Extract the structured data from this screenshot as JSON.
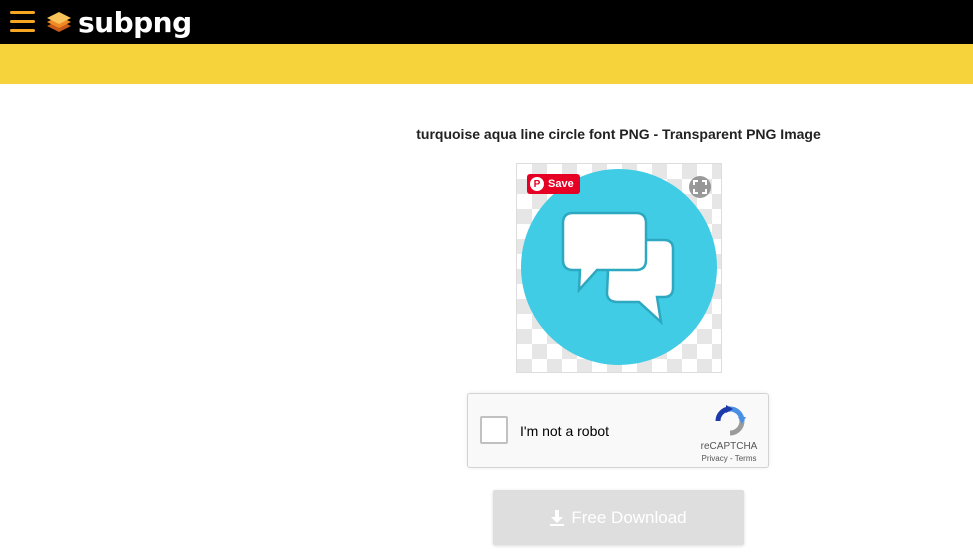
{
  "header": {
    "logo_text": "subpng",
    "menu_icon": "hamburger-icon",
    "colors": {
      "bar": "#000000",
      "accent": "#f5a623",
      "yellow_band": "#f6d33a"
    }
  },
  "main": {
    "title": "turquoise aqua line circle font PNG - Transparent PNG Image",
    "preview": {
      "icon": "chat-bubbles-icon",
      "circle_color": "#40cce5",
      "pinterest_label": "Save",
      "pinterest_logo": "P",
      "expand_icon": "expand-icon"
    },
    "recaptcha": {
      "label": "I'm not a robot",
      "brand": "reCAPTCHA",
      "privacy": "Privacy",
      "separator": " - ",
      "terms": "Terms"
    },
    "download": {
      "label": "Free Download",
      "icon": "download-icon"
    }
  }
}
